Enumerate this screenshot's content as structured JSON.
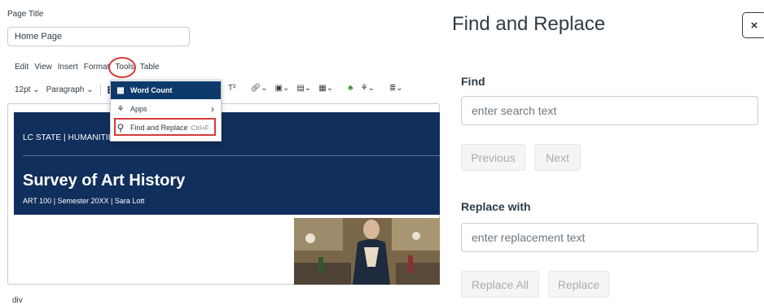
{
  "editor": {
    "page_title_label": "Page Title",
    "page_title_value": "Home Page",
    "menu": [
      "Edit",
      "View",
      "Insert",
      "Format",
      "Tools",
      "Table"
    ],
    "toolbar": {
      "font_size": "12pt",
      "block_format": "Paragraph",
      "bold": "B",
      "superscript": "T²",
      "items": [
        "link",
        "image",
        "media",
        "document",
        "apps",
        "more"
      ]
    },
    "banner": {
      "dept": "LC STATE | HUMANITIES",
      "course": "Survey of Art History",
      "subtitle": "ART 100 | Semester 20XX | Sara Lott",
      "color": "#102f5c"
    },
    "path": "div"
  },
  "tools_menu": {
    "items": [
      {
        "label": "Word Count",
        "icon": "word-count-icon"
      },
      {
        "label": "Apps",
        "icon": "apps-icon"
      },
      {
        "label": "Find and Replace",
        "shortcut": "Ctrl+F",
        "icon": "search-icon"
      }
    ]
  },
  "panel": {
    "title": "Find and Replace",
    "close": "×",
    "find_label": "Find",
    "find_placeholder": "enter search text",
    "previous": "Previous",
    "next": "Next",
    "replace_label": "Replace with",
    "replace_placeholder": "enter replacement text",
    "replace_all": "Replace All",
    "replace": "Replace"
  },
  "colors": {
    "highlight": "#d73b3b",
    "menu_active": "#0e3a6b"
  }
}
